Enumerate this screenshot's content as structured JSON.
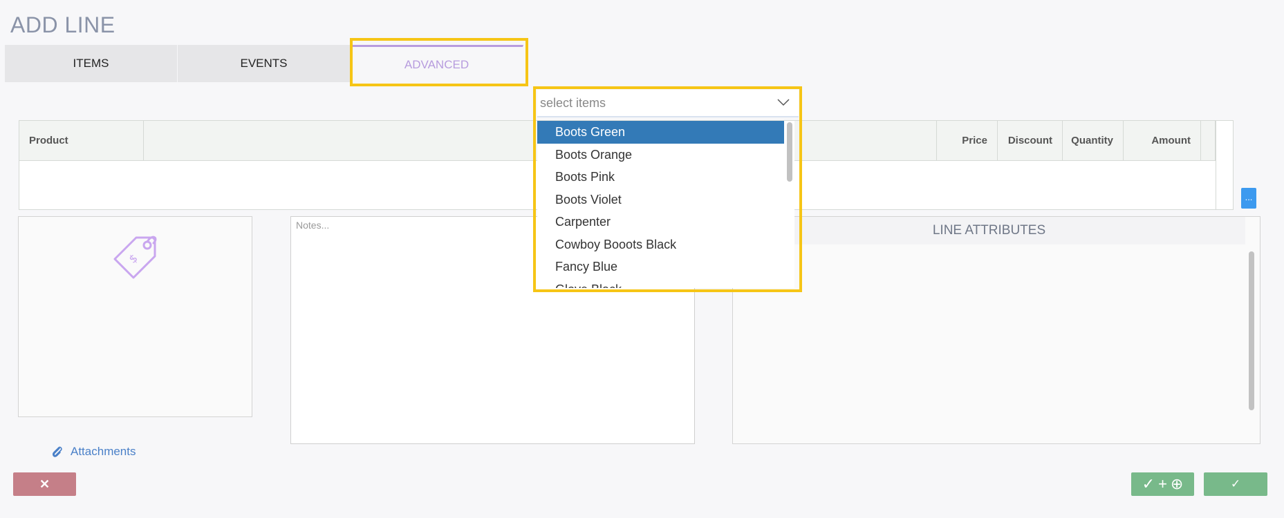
{
  "page": {
    "title": "ADD LINE"
  },
  "tabs": [
    {
      "label": "ITEMS"
    },
    {
      "label": "EVENTS"
    },
    {
      "label": "ADVANCED"
    }
  ],
  "select": {
    "placeholder": "select items",
    "options": [
      "Boots Green",
      "Boots Orange",
      "Boots Pink",
      "Boots Violet",
      "Carpenter",
      "Cowboy Booots Black",
      "Fancy Blue",
      "Glove Black"
    ],
    "selected_index": 0
  },
  "grid": {
    "columns": [
      "Product",
      "",
      "Price",
      "Discount",
      "Quantity",
      "Amount"
    ],
    "more_label": "..."
  },
  "notes": {
    "placeholder": "Notes..."
  },
  "attributes": {
    "title": "LINE ATTRIBUTES"
  },
  "attachments": {
    "label": "Attachments"
  },
  "buttons": {
    "cancel": "✕",
    "save_add_check": "✓",
    "save_add_plus": "+",
    "save_add_circle": "⊕",
    "save": "✓"
  },
  "colors": {
    "accent": "#b79cde",
    "highlight": "#f6c516",
    "selected": "#337ab7",
    "confirm": "#78b98a",
    "cancel": "#c57f88"
  }
}
